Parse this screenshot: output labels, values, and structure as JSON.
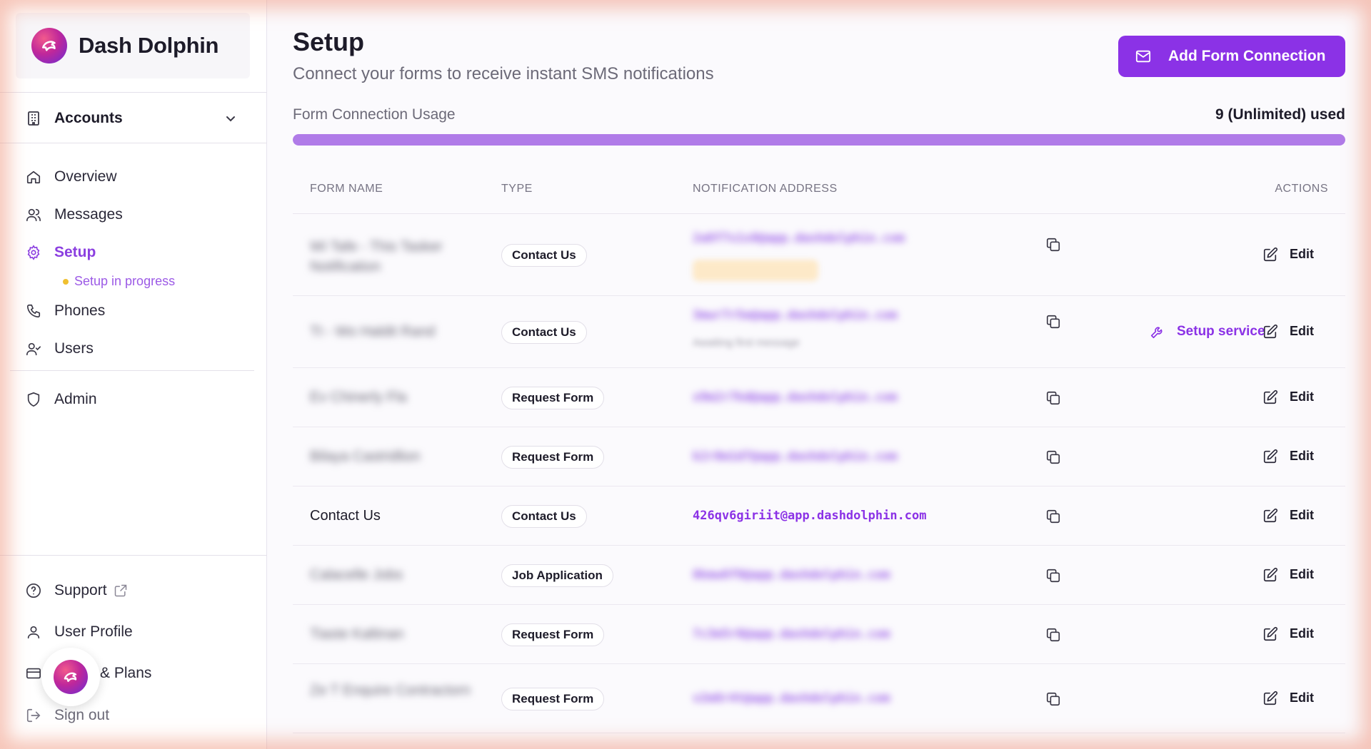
{
  "app": {
    "brand_name": "Dash Dolphin",
    "accent_color": "#8b32e6"
  },
  "sidebar": {
    "accounts_label": "Accounts",
    "nav": [
      {
        "label": "Overview",
        "icon": "home-icon"
      },
      {
        "label": "Messages",
        "icon": "users-icon"
      },
      {
        "label": "Setup",
        "icon": "gear-icon",
        "active": true
      },
      {
        "label": "Phones",
        "icon": "phone-icon"
      },
      {
        "label": "Users",
        "icon": "user-check-icon"
      },
      {
        "label": "Admin",
        "icon": "shield-icon"
      }
    ],
    "setup_status": "Setup in progress",
    "footer": [
      {
        "label": "Support",
        "icon": "help-circle-icon"
      },
      {
        "label": "User Profile",
        "icon": "user-icon"
      },
      {
        "label": "& Plans",
        "icon": "credit-card-icon"
      },
      {
        "label": "Sign out",
        "icon": "sign-out-icon"
      }
    ]
  },
  "header": {
    "title": "Setup",
    "subtitle": "Connect your forms to receive instant SMS notifications",
    "add_button_label": "Add Form Connection"
  },
  "usage": {
    "label": "Form Connection Usage",
    "count_text": "9 (Unlimited) used",
    "fill_fraction": 1.0
  },
  "table": {
    "columns": [
      "Form Name",
      "Type",
      "Notification Address",
      "Actions"
    ],
    "rows": [
      {
        "form_name": "Wi Tafe - This Tasker Notification",
        "form_name_blurred": true,
        "type": "Contact Us",
        "address": "2a8f7s1s8@app.dashdolphin.com",
        "address_blurred": true,
        "has_status_pill": true,
        "setup_service": false,
        "edit_label": "Edit"
      },
      {
        "form_name": "Tt - Wo Haldit Rand",
        "form_name_blurred": true,
        "type": "Contact Us",
        "address": "3mwr7r5e@app.dashdolphin.com",
        "address_blurred": true,
        "subline": "Awaiting first message",
        "setup_service": true,
        "setup_service_label": "Setup service",
        "edit_label": "Edit"
      },
      {
        "form_name": "Ev Chinerly Fla",
        "form_name_blurred": true,
        "type": "Request Form",
        "address": "x9m2r7kd@app.dashdolphin.com",
        "address_blurred": true,
        "setup_service": false,
        "edit_label": "Edit"
      },
      {
        "form_name": "Bilaya Castridlion",
        "form_name_blurred": true,
        "type": "Request Form",
        "address": "k2r8m1d7@app.dashdolphin.com",
        "address_blurred": true,
        "setup_service": false,
        "edit_label": "Edit"
      },
      {
        "form_name": "Contact Us",
        "form_name_blurred": false,
        "type": "Contact Us",
        "address": "426qv6giriit@app.dashdolphin.com",
        "address_blurred": false,
        "setup_service": false,
        "edit_label": "Edit"
      },
      {
        "form_name": "Calacelle Jobs",
        "form_name_blurred": true,
        "type": "Job Application",
        "address": "8kmw6f9@app.dashdolphin.com",
        "address_blurred": true,
        "setup_service": false,
        "edit_label": "Edit"
      },
      {
        "form_name": "Tiaste Kaltinan",
        "form_name_blurred": true,
        "type": "Request Form",
        "address": "7c3m5r8@app.dashdolphin.com",
        "address_blurred": true,
        "setup_service": false,
        "edit_label": "Edit"
      },
      {
        "form_name": "Ze T Enquire Contractorn",
        "form_name_blurred": true,
        "type": "Request Form",
        "address": "v2m8r4t@app.dashdolphin.com",
        "address_blurred": true,
        "setup_service": false,
        "edit_label": "Edit"
      }
    ]
  }
}
